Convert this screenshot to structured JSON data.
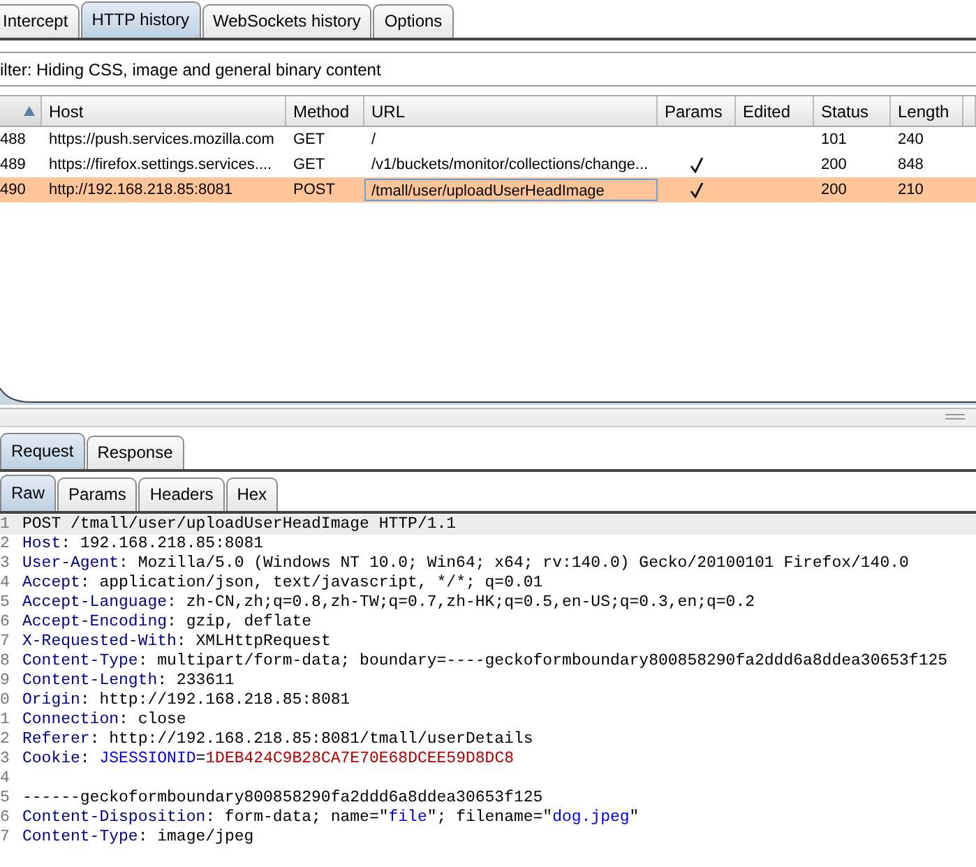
{
  "main_tabs": [
    {
      "label": "Intercept",
      "selected": false
    },
    {
      "label": "HTTP history",
      "selected": true
    },
    {
      "label": "WebSockets history",
      "selected": false
    },
    {
      "label": "Options",
      "selected": false
    }
  ],
  "filter": "ilter: Hiding CSS, image and general binary content",
  "table": {
    "columns": [
      {
        "sorted": true
      },
      {
        "label": "Host",
        "sorted": false
      },
      {
        "label": "Method",
        "sorted": false
      },
      {
        "label": "URL",
        "sorted": false
      },
      {
        "label": "Params",
        "sorted": false
      },
      {
        "label": "Edited",
        "sorted": false
      },
      {
        "label": "Status",
        "sorted": false
      },
      {
        "label": "Length",
        "sorted": false
      }
    ],
    "rows": [
      {
        "id": "488",
        "host": "https://push.services.mozilla.com",
        "method": "GET",
        "url": "/",
        "params": false,
        "status": "101",
        "length": "240",
        "selected": false
      },
      {
        "id": "489",
        "host": "https://firefox.settings.services....",
        "method": "GET",
        "url": "/v1/buckets/monitor/collections/change...",
        "params": true,
        "status": "200",
        "length": "848",
        "selected": false
      },
      {
        "id": "490",
        "host": "http://192.168.218.85:8081",
        "method": "POST",
        "url": "/tmall/user/uploadUserHeadImage",
        "params": true,
        "status": "200",
        "length": "210",
        "selected": true
      }
    ]
  },
  "message_tabs": [
    {
      "label": "Request",
      "selected": true
    },
    {
      "label": "Response",
      "selected": false
    }
  ],
  "view_tabs": [
    {
      "label": "Raw",
      "selected": true
    },
    {
      "label": "Params",
      "selected": false
    },
    {
      "label": "Headers",
      "selected": false
    },
    {
      "label": "Hex",
      "selected": false
    }
  ],
  "editor": {
    "lines": [
      {
        "number": "1",
        "current": true,
        "segments": [
          {
            "kind": "plain",
            "text": "POST /tmall/user/uploadUserHeadImage HTTP/1.1"
          }
        ]
      },
      {
        "number": "2",
        "current": false,
        "segments": [
          {
            "kind": "name",
            "text": "Host"
          },
          {
            "kind": "plain",
            "text": ": 192.168.218.85:8081"
          }
        ]
      },
      {
        "number": "3",
        "current": false,
        "segments": [
          {
            "kind": "name",
            "text": "User-Agent"
          },
          {
            "kind": "plain",
            "text": ": Mozilla/5.0 (Windows NT 10.0; Win64; x64; rv:140.0) Gecko/20100101 Firefox/140.0"
          }
        ]
      },
      {
        "number": "4",
        "current": false,
        "segments": [
          {
            "kind": "name",
            "text": "Accept"
          },
          {
            "kind": "plain",
            "text": ": application/json, text/javascript, */*; q=0.01"
          }
        ]
      },
      {
        "number": "5",
        "current": false,
        "segments": [
          {
            "kind": "name",
            "text": "Accept-Language"
          },
          {
            "kind": "plain",
            "text": ": zh-CN,zh;q=0.8,zh-TW;q=0.7,zh-HK;q=0.5,en-US;q=0.3,en;q=0.2"
          }
        ]
      },
      {
        "number": "6",
        "current": false,
        "segments": [
          {
            "kind": "name",
            "text": "Accept-Encoding"
          },
          {
            "kind": "plain",
            "text": ": gzip, deflate"
          }
        ]
      },
      {
        "number": "7",
        "current": false,
        "segments": [
          {
            "kind": "name",
            "text": "X-Requested-With"
          },
          {
            "kind": "plain",
            "text": ": XMLHttpRequest"
          }
        ]
      },
      {
        "number": "8",
        "current": false,
        "segments": [
          {
            "kind": "name",
            "text": "Content-Type"
          },
          {
            "kind": "plain",
            "text": ": multipart/form-data; boundary=----geckoformboundary800858290fa2ddd6a8ddea30653f125"
          }
        ]
      },
      {
        "number": "9",
        "current": false,
        "segments": [
          {
            "kind": "name",
            "text": "Content-Length"
          },
          {
            "kind": "plain",
            "text": ": 233611"
          }
        ]
      },
      {
        "number": "0",
        "current": false,
        "segments": [
          {
            "kind": "name",
            "text": "Origin"
          },
          {
            "kind": "plain",
            "text": ": http://192.168.218.85:8081"
          }
        ]
      },
      {
        "number": "1",
        "current": false,
        "segments": [
          {
            "kind": "name",
            "text": "Connection"
          },
          {
            "kind": "plain",
            "text": ": close"
          }
        ]
      },
      {
        "number": "2",
        "current": false,
        "segments": [
          {
            "kind": "name",
            "text": "Referer"
          },
          {
            "kind": "plain",
            "text": ": http://192.168.218.85:8081/tmall/userDetails"
          }
        ]
      },
      {
        "number": "3",
        "current": false,
        "segments": [
          {
            "kind": "name",
            "text": "Cookie"
          },
          {
            "kind": "plain",
            "text": ": "
          },
          {
            "kind": "cookie-name",
            "text": "JSESSIONID"
          },
          {
            "kind": "plain",
            "text": "="
          },
          {
            "kind": "cookie-value",
            "text": "1DEB424C9B28CA7E70E68DCEE59D8DC8"
          }
        ]
      },
      {
        "number": "4",
        "current": false
      },
      {
        "number": "5",
        "current": false,
        "segments": [
          {
            "kind": "plain",
            "text": "------geckoformboundary800858290fa2ddd6a8ddea30653f125"
          }
        ]
      },
      {
        "number": "6",
        "current": false,
        "segments": [
          {
            "kind": "name",
            "text": "Content-Disposition"
          },
          {
            "kind": "plain",
            "text": ": form-data; name=\""
          },
          {
            "kind": "quoted",
            "text": "file"
          },
          {
            "kind": "plain",
            "text": "\"; filename=\""
          },
          {
            "kind": "quoted",
            "text": "dog.jpeg"
          },
          {
            "kind": "plain",
            "text": "\""
          }
        ]
      },
      {
        "number": "7",
        "current": false,
        "segments": [
          {
            "kind": "name",
            "text": "Content-Type"
          },
          {
            "kind": "plain",
            "text": ": image/jpeg"
          }
        ]
      }
    ]
  }
}
